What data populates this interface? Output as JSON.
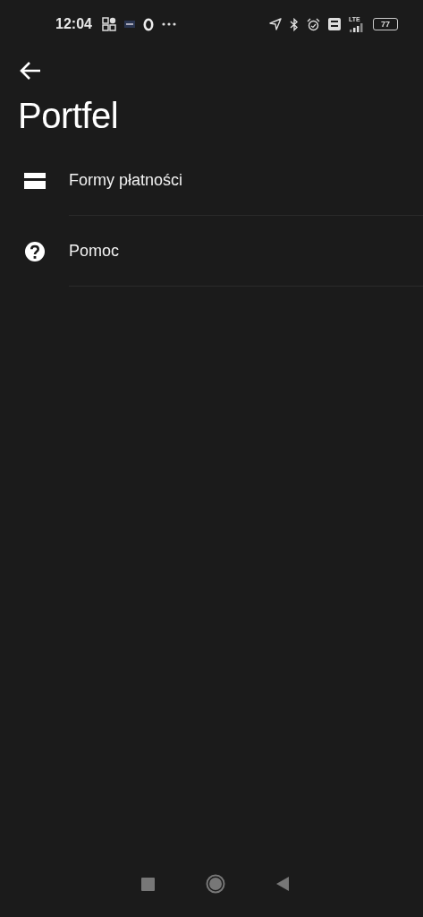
{
  "status_bar": {
    "time": "12:04",
    "network": "LTE",
    "battery": "77"
  },
  "header": {
    "title": "Portfel"
  },
  "menu": [
    {
      "kind": "card",
      "label": "Formy płatności"
    },
    {
      "kind": "help",
      "label": "Pomoc"
    }
  ]
}
